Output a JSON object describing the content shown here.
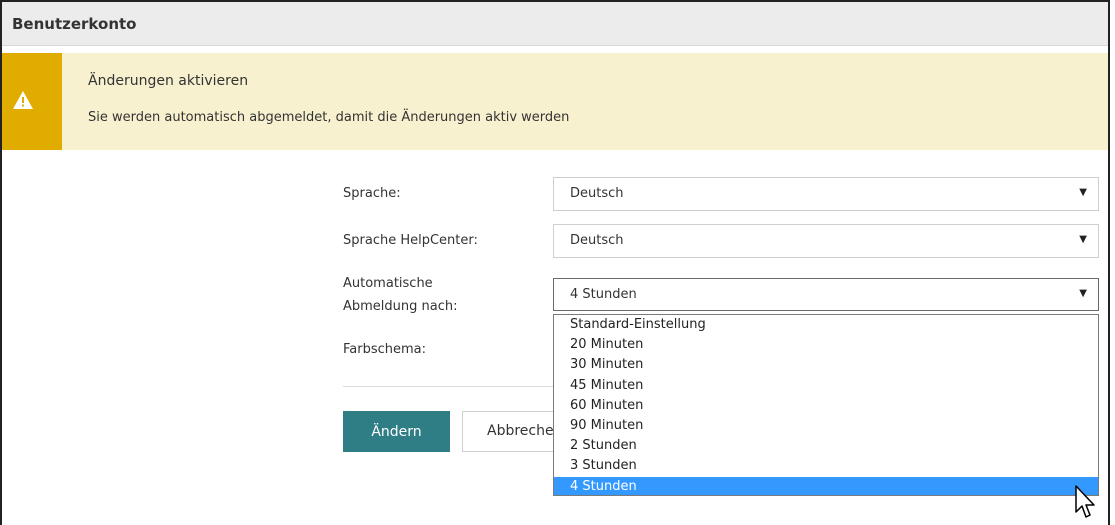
{
  "window": {
    "title": "Benutzerkonto"
  },
  "alert": {
    "title": "Änderungen aktivieren",
    "message": "Sie werden automatisch abgemeldet, damit die Änderungen aktiv werden",
    "icon": "warning-icon",
    "color": "#e0ac00"
  },
  "form": {
    "language": {
      "label": "Sprache:",
      "value": "Deutsch"
    },
    "helpcenter_language": {
      "label": "Sprache HelpCenter:",
      "value": "Deutsch"
    },
    "auto_logout": {
      "label_line1": "Automatische",
      "label_line2": "Abmeldung nach:",
      "value": "4 Stunden",
      "options": [
        "Standard-Einstellung",
        "20 Minuten",
        "30 Minuten",
        "45 Minuten",
        "60 Minuten",
        "90 Minuten",
        "2 Stunden",
        "3 Stunden",
        "4 Stunden"
      ],
      "highlighted_option": "4 Stunden"
    },
    "color_scheme": {
      "label": "Farbschema:"
    }
  },
  "buttons": {
    "submit": "Ändern",
    "cancel": "Abbrechen",
    "primary_color": "#2f7d85"
  }
}
